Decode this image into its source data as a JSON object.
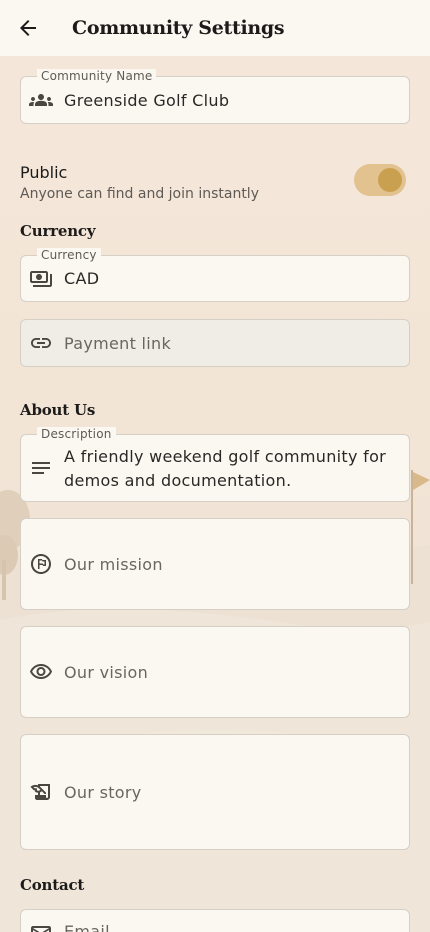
{
  "app_bar": {
    "title": "Community Settings",
    "back_icon": "arrow-back-icon"
  },
  "community_name": {
    "label": "Community Name",
    "value": "Greenside Golf Club",
    "icon": "groups-icon"
  },
  "public": {
    "label": "Public",
    "description": "Anyone can find and join instantly",
    "enabled": true
  },
  "currency_section": {
    "heading": "Currency",
    "field_label": "Currency",
    "value": "CAD",
    "icon": "payments-icon"
  },
  "payment_link": {
    "placeholder": "Payment link",
    "icon": "link-icon"
  },
  "about_section": {
    "heading": "About Us",
    "description_label": "Description",
    "description_value": "A friendly weekend golf community for demos and documentation.",
    "description_icon": "notes-icon",
    "mission_placeholder": "Our mission",
    "mission_icon": "flag-circle-icon",
    "vision_placeholder": "Our vision",
    "vision_icon": "eye-icon",
    "story_placeholder": "Our story",
    "story_icon": "history-edu-icon"
  },
  "contact_section": {
    "heading": "Contact",
    "email_placeholder": "Email",
    "email_icon": "mail-icon"
  },
  "colors": {
    "toggle_track": "#e2c28f",
    "toggle_thumb": "#c9a04f",
    "surface": "#fbf8f2",
    "background": "#f3e6d8"
  }
}
